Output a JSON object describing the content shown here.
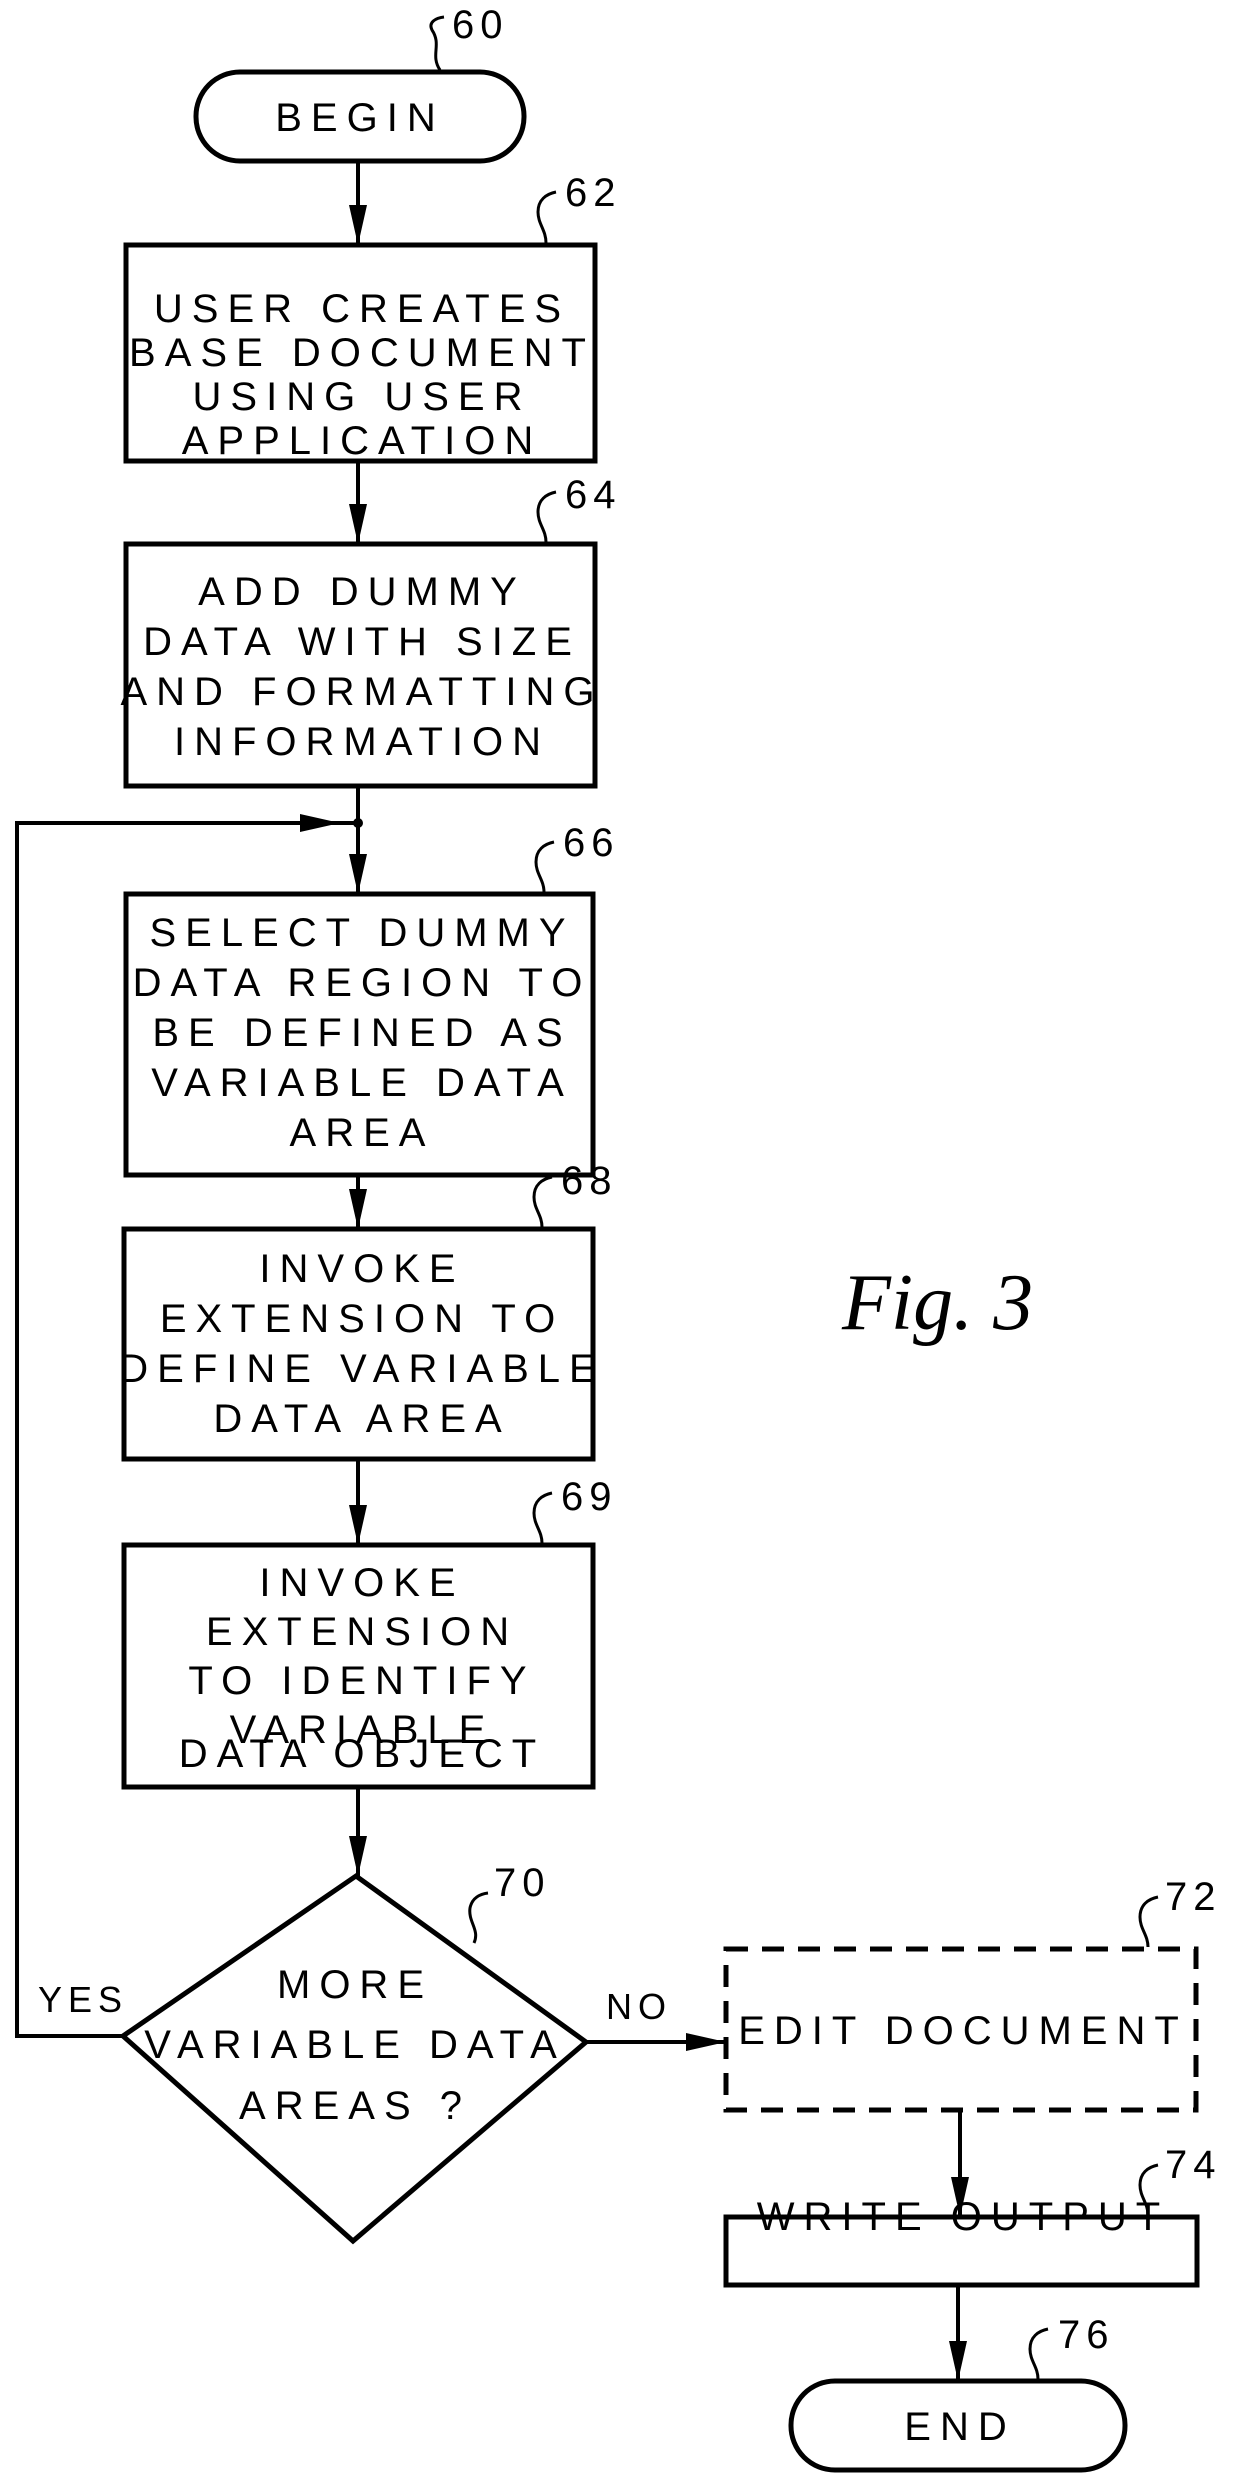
{
  "figure": {
    "caption": "Fig. 3",
    "nodes": [
      {
        "id": "60",
        "type": "terminal",
        "ref": "60",
        "lines": [
          "BEGIN"
        ]
      },
      {
        "id": "62",
        "type": "process",
        "ref": "62",
        "lines": [
          "USER CREATES",
          "BASE DOCUMENT",
          "USING USER",
          "APPLICATION"
        ]
      },
      {
        "id": "64",
        "type": "process",
        "ref": "64",
        "lines": [
          "ADD DUMMY",
          "DATA WITH SIZE",
          "AND FORMATTING",
          "INFORMATION"
        ]
      },
      {
        "id": "66",
        "type": "process",
        "ref": "66",
        "lines": [
          "SELECT DUMMY",
          "DATA REGION TO",
          "BE DEFINED AS",
          "VARIABLE DATA",
          "AREA"
        ]
      },
      {
        "id": "68",
        "type": "process",
        "ref": "68",
        "lines": [
          "INVOKE",
          "EXTENSION TO",
          "DEFINE VARIABLE",
          "DATA AREA"
        ]
      },
      {
        "id": "69",
        "type": "process",
        "ref": "69",
        "lines": [
          "INVOKE",
          "EXTENSION",
          "TO IDENTIFY",
          "VARIABLE",
          "DATA OBJECT"
        ]
      },
      {
        "id": "70",
        "type": "decision",
        "ref": "70",
        "lines": [
          "MORE",
          "VARIABLE DATA",
          "AREAS ?"
        ]
      },
      {
        "id": "72",
        "type": "optional-process",
        "ref": "72",
        "lines": [
          "EDIT DOCUMENT"
        ]
      },
      {
        "id": "74",
        "type": "process",
        "ref": "74",
        "lines": [
          "WRITE OUTPUT"
        ]
      },
      {
        "id": "76",
        "type": "terminal",
        "ref": "76",
        "lines": [
          "END"
        ]
      }
    ],
    "edges": [
      {
        "from": "60",
        "to": "62",
        "label": ""
      },
      {
        "from": "62",
        "to": "64",
        "label": ""
      },
      {
        "from": "64",
        "to": "66",
        "label": ""
      },
      {
        "from": "66",
        "to": "68",
        "label": ""
      },
      {
        "from": "68",
        "to": "69",
        "label": ""
      },
      {
        "from": "69",
        "to": "70",
        "label": ""
      },
      {
        "from": "70",
        "to": "66",
        "label": "YES"
      },
      {
        "from": "70",
        "to": "72",
        "label": "NO"
      },
      {
        "from": "72",
        "to": "74",
        "label": ""
      },
      {
        "from": "74",
        "to": "76",
        "label": ""
      }
    ],
    "branch_labels": {
      "yes": "YES",
      "no": "NO"
    }
  }
}
